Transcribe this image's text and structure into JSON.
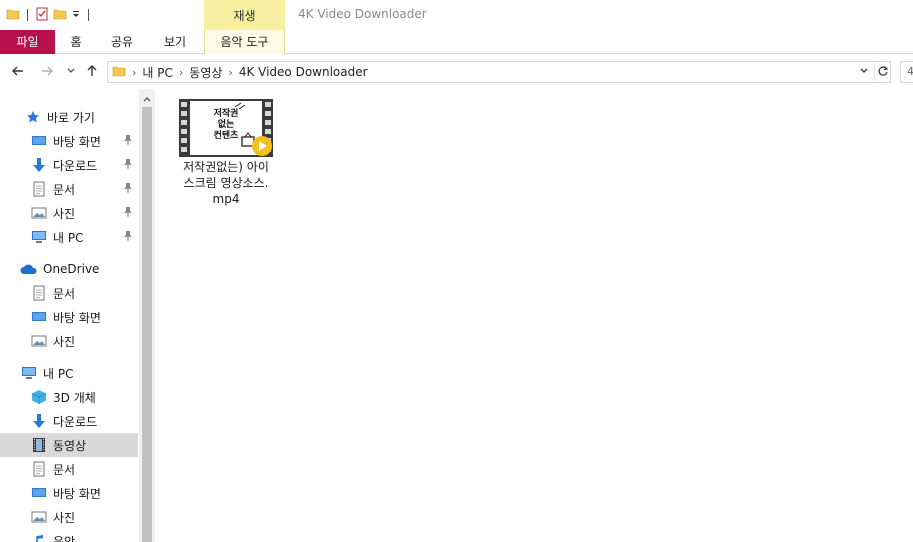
{
  "window": {
    "title": "4K Video Downloader",
    "context_tab_header": "재생"
  },
  "ribbon": {
    "tabs": [
      {
        "label": "파일"
      },
      {
        "label": "홈"
      },
      {
        "label": "공유"
      },
      {
        "label": "보기"
      },
      {
        "label": "음악 도구"
      }
    ]
  },
  "address": {
    "breadcrumbs": [
      "내 PC",
      "동영상",
      "4K Video Downloader"
    ],
    "search_fragment": "4"
  },
  "nav": {
    "items": [
      {
        "label": "바로 가기",
        "icon": "star-icon",
        "pinned": false
      },
      {
        "label": "바탕 화면",
        "icon": "desktop-icon",
        "pinned": true
      },
      {
        "label": "다운로드",
        "icon": "download-icon",
        "pinned": true
      },
      {
        "label": "문서",
        "icon": "document-icon",
        "pinned": true
      },
      {
        "label": "사진",
        "icon": "picture-icon",
        "pinned": true
      },
      {
        "label": "내 PC",
        "icon": "computer-icon",
        "pinned": true
      },
      {
        "label": "OneDrive",
        "icon": "cloud-icon",
        "pinned": false
      },
      {
        "label": "문서",
        "icon": "document-icon",
        "pinned": false
      },
      {
        "label": "바탕 화면",
        "icon": "desktop-icon",
        "pinned": false
      },
      {
        "label": "사진",
        "icon": "picture-icon",
        "pinned": false
      },
      {
        "label": "내 PC",
        "icon": "computer-icon",
        "pinned": false
      },
      {
        "label": "3D 개체",
        "icon": "3d-objects-icon",
        "pinned": false
      },
      {
        "label": "다운로드",
        "icon": "download-icon",
        "pinned": false
      },
      {
        "label": "동영상",
        "icon": "video-icon",
        "pinned": false,
        "selected": true
      },
      {
        "label": "문서",
        "icon": "document-icon",
        "pinned": false
      },
      {
        "label": "바탕 화면",
        "icon": "desktop-icon",
        "pinned": false
      },
      {
        "label": "사진",
        "icon": "picture-icon",
        "pinned": false
      },
      {
        "label": "음악",
        "icon": "music-icon",
        "pinned": false
      }
    ]
  },
  "files": [
    {
      "name": "저작권없는) 아이스크림 영상소스.mp4",
      "name_lines": [
        "저작권없는) 아이",
        "스크림 영상소스.",
        "mp4"
      ],
      "thumb_text": [
        "저작권",
        "없는",
        "컨텐츠"
      ]
    }
  ],
  "colors": {
    "file_tab": "#b8124e",
    "context_tab": "#f6f0a0",
    "selected_nav": "#d9d9d9",
    "folder": "#f5c84c",
    "icon_blue": "#2b78d4",
    "play_badge": "#f2c21a"
  }
}
